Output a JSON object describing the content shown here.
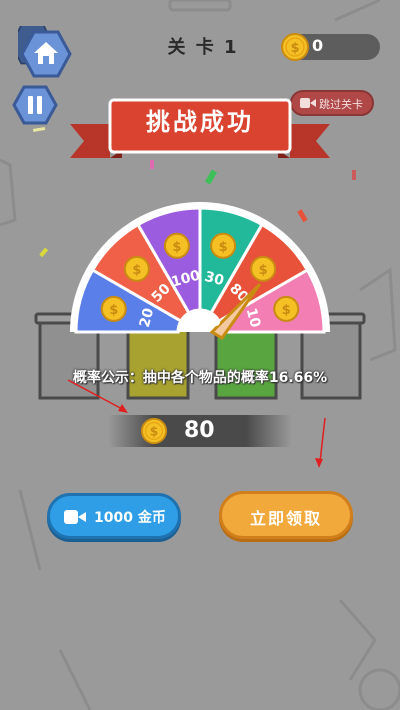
{
  "header": {
    "level_title": "关 卡 1",
    "coin_count": "0",
    "skip_label": "跳过关卡"
  },
  "banner": {
    "title": "挑战成功"
  },
  "wheel": {
    "segments": [
      {
        "value": "20",
        "color": "#5b7fe8"
      },
      {
        "value": "50",
        "color": "#f05f47"
      },
      {
        "value": "100",
        "color": "#9c5ce0"
      },
      {
        "value": "30",
        "color": "#22b99a"
      },
      {
        "value": "80",
        "color": "#e8513a"
      },
      {
        "value": "10",
        "color": "#f27eb3"
      }
    ]
  },
  "probability_text": "概率公示：抽中各个物品的概率16.66%",
  "reward": {
    "amount": "80"
  },
  "buttons": {
    "video_label": "1000 金币",
    "claim_label": "立即领取"
  },
  "colors": {
    "background": "#9a9a9a",
    "banner_red": "#d9432f",
    "video_blue": "#2f9ee6",
    "claim_orange": "#f2a93b",
    "coin_gold": "#f5c024"
  }
}
